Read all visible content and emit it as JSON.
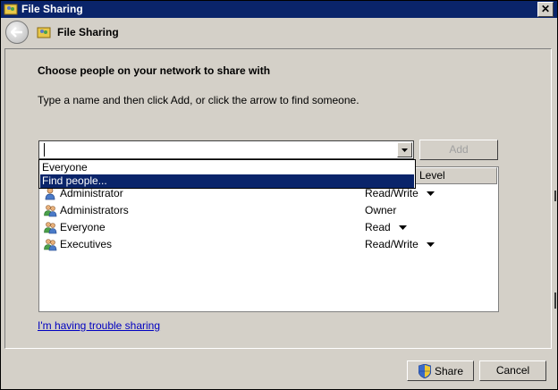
{
  "window": {
    "title": "File Sharing",
    "close_glyph": "✕"
  },
  "nav": {
    "title": "File Sharing"
  },
  "heading": "Choose people on your network to share with",
  "instruction": "Type a name and then click Add, or click the arrow to find someone.",
  "name_input": {
    "value": "",
    "placeholder": ""
  },
  "add_button": {
    "label": "Add",
    "enabled": false
  },
  "dropdown": {
    "items": [
      "Everyone",
      "Find people..."
    ],
    "selected_index": 1
  },
  "columns": {
    "level": "Level"
  },
  "users": [
    {
      "name": "Administrator",
      "permission": "Read/Write",
      "has_arrow": true,
      "icon": "user-icon"
    },
    {
      "name": "Administrators",
      "permission": "Owner",
      "has_arrow": false,
      "icon": "group-icon"
    },
    {
      "name": "Everyone",
      "permission": "Read",
      "has_arrow": true,
      "icon": "group-icon"
    },
    {
      "name": "Executives",
      "permission": "Read/Write",
      "has_arrow": true,
      "icon": "group-icon"
    }
  ],
  "trouble_link": "I'm having trouble sharing",
  "share_button": {
    "label": "Share"
  },
  "cancel_button": {
    "label": "Cancel"
  },
  "colors": {
    "title_bar": "#0a246a",
    "selection": "#0a246a",
    "link": "#0000c0",
    "face": "#d4d0c8"
  }
}
